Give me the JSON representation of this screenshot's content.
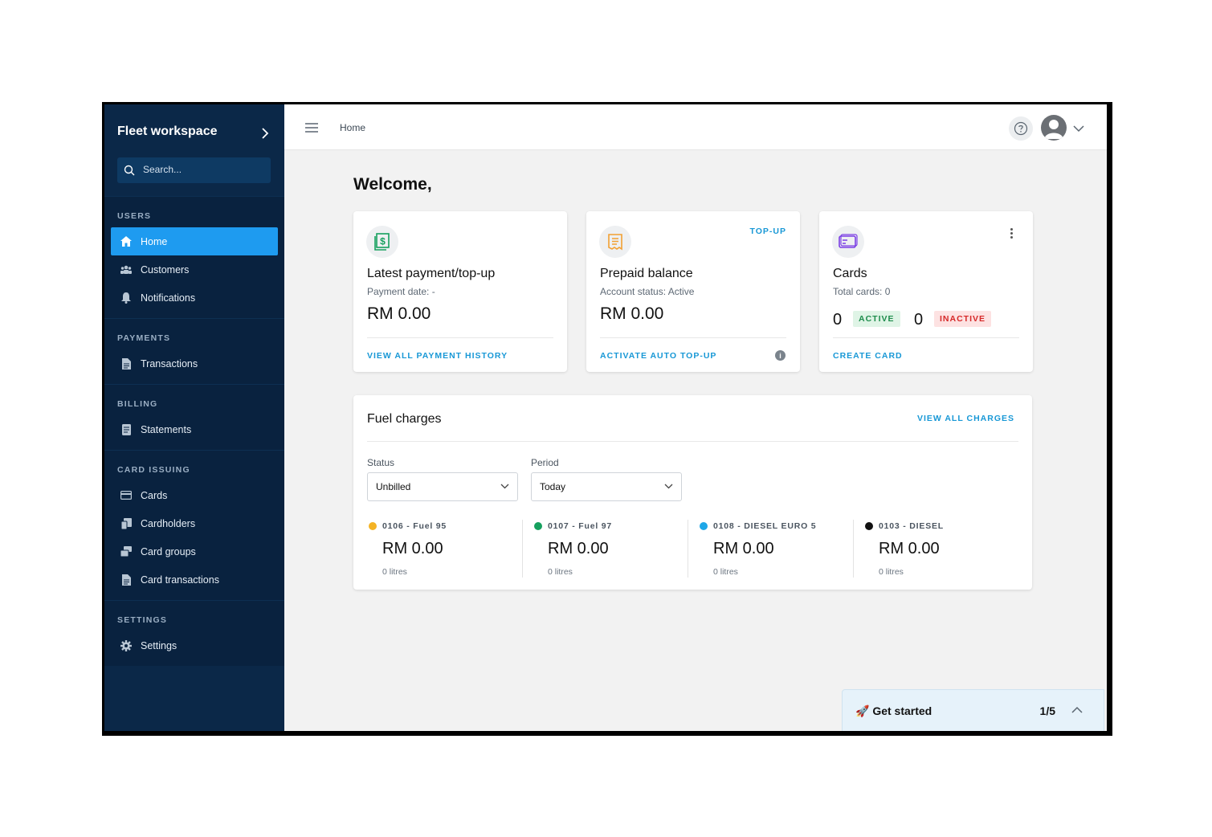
{
  "sidebar": {
    "workspace_title": "Fleet workspace",
    "search_placeholder": "Search...",
    "sections": [
      {
        "title": "USERS",
        "items": [
          {
            "label": "Home"
          },
          {
            "label": "Customers"
          },
          {
            "label": "Notifications"
          }
        ]
      },
      {
        "title": "PAYMENTS",
        "items": [
          {
            "label": "Transactions"
          }
        ]
      },
      {
        "title": "BILLING",
        "items": [
          {
            "label": "Statements"
          }
        ]
      },
      {
        "title": "CARD ISSUING",
        "items": [
          {
            "label": "Cards"
          },
          {
            "label": "Cardholders"
          },
          {
            "label": "Card groups"
          },
          {
            "label": "Card transactions"
          }
        ]
      },
      {
        "title": "SETTINGS",
        "items": [
          {
            "label": "Settings"
          }
        ]
      }
    ]
  },
  "header": {
    "breadcrumb": "Home"
  },
  "main": {
    "welcome": "Welcome,",
    "cards": {
      "payment": {
        "title": "Latest payment/top-up",
        "subtitle": "Payment date: -",
        "amount": "RM 0.00",
        "link": "VIEW ALL PAYMENT HISTORY"
      },
      "prepaid": {
        "tag": "TOP-UP",
        "title": "Prepaid balance",
        "subtitle": "Account status: Active",
        "amount": "RM 0.00",
        "link": "ACTIVATE AUTO TOP-UP"
      },
      "cards": {
        "title": "Cards",
        "subtitle": "Total cards: 0",
        "active_count": "0",
        "active_label": "ACTIVE",
        "inactive_count": "0",
        "inactive_label": "INACTIVE",
        "link": "CREATE CARD"
      }
    },
    "fuel": {
      "title": "Fuel charges",
      "link": "VIEW ALL CHARGES",
      "status_label": "Status",
      "status_value": "Unbilled",
      "period_label": "Period",
      "period_value": "Today",
      "items": [
        {
          "name": "0106 - Fuel 95",
          "amount": "RM 0.00",
          "litres": "0 litres",
          "color": "#f4b324"
        },
        {
          "name": "0107 - Fuel 97",
          "amount": "RM 0.00",
          "litres": "0 litres",
          "color": "#16a05e"
        },
        {
          "name": "0108 - DIESEL EURO 5",
          "amount": "RM 0.00",
          "litres": "0 litres",
          "color": "#1ea7e8"
        },
        {
          "name": "0103 - DIESEL",
          "amount": "RM 0.00",
          "litres": "0 litres",
          "color": "#111111"
        }
      ]
    }
  },
  "get_started": {
    "label": "🚀 Get started",
    "progress": "1/5"
  },
  "colors": {
    "sidebar_bg": "#0b2848",
    "accent": "#1e9bf0",
    "link": "#1898d6"
  }
}
